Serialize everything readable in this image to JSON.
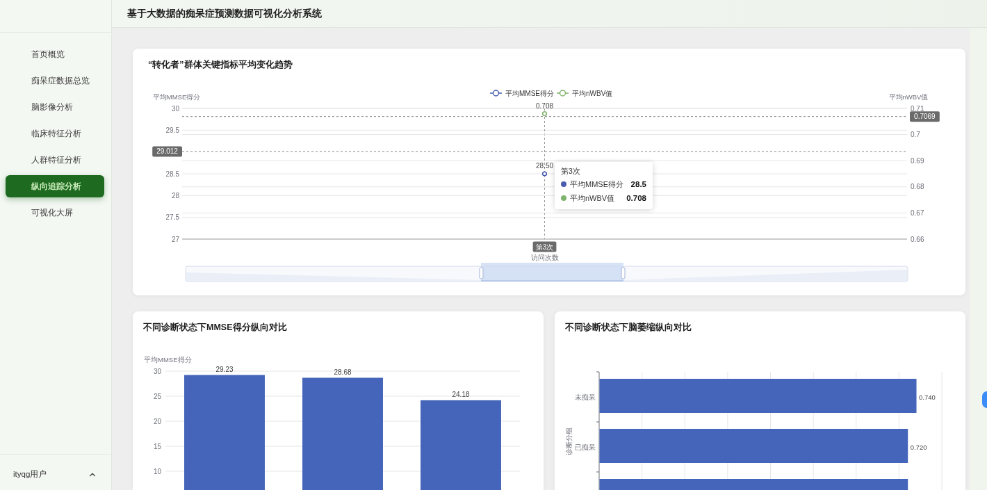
{
  "sidebar": {
    "nav_items": [
      {
        "label": "首页概览",
        "selected": false
      },
      {
        "label": "痴呆症数据总览",
        "selected": false
      },
      {
        "label": "脑影像分析",
        "selected": false
      },
      {
        "label": "临床特征分析",
        "selected": false
      },
      {
        "label": "人群特征分析",
        "selected": false
      },
      {
        "label": "纵向追踪分析",
        "selected": true
      },
      {
        "label": "可视化大屏",
        "selected": false
      }
    ],
    "user": {
      "name": "ityqg用户"
    }
  },
  "header": {
    "title": "基于大数据的痴呆症预测数据可视化分析系统"
  },
  "trend_card": {
    "title": "“转化者”群体关键指标平均变化趋势",
    "chart_data": {
      "type": "line",
      "xlabel": "访问次数",
      "ylabel": "平均MMSE得分",
      "categories": [
        "第3次"
      ],
      "series": [
        {
          "name": "平均MMSE得分",
          "color": "#4a5cb0",
          "marker": "circle",
          "values": [
            28.5
          ],
          "value_labels": [
            "28.50"
          ]
        }
      ],
      "ylim": [
        27,
        30
      ],
      "yticks": [
        27,
        27.5,
        28,
        28.5,
        29.5,
        30
      ],
      "grid": true,
      "ref_lines": [
        {
          "axis": "y",
          "value": 29.012,
          "label": "29.012"
        },
        {
          "axis": "x",
          "value": "第3次"
        }
      ]
    },
    "right_axis": {
      "chart_data": {
        "type": "line",
        "ylabel": "平均nWBV值",
        "series": [
          {
            "name": "平均nWBV值",
            "color": "#7fb46d",
            "marker": "circle",
            "values": [
              0.708
            ],
            "value_labels": [
              "0.708"
            ]
          }
        ],
        "ylim": [
          0.66,
          0.71
        ],
        "yticks": [
          0.66,
          0.67,
          0.68,
          0.69,
          0.7,
          0.71
        ],
        "grid": true,
        "ref_lines": [
          {
            "axis": "y",
            "value": 0.7069,
            "label": "0.7069"
          }
        ]
      }
    },
    "tooltip": {
      "title": "第3次",
      "rows": [
        {
          "name": "平均MMSE得分",
          "value": "28.5",
          "color": "#4a5cb0"
        },
        {
          "name": "平均nWBV值",
          "value": "0.708",
          "color": "#7fb46d"
        }
      ]
    }
  },
  "mmse_card": {
    "title": "不同诊断状态下MMSE得分纵向对比",
    "chart_data": {
      "type": "bar",
      "ylabel": "平均MMSE得分",
      "values": [
        29.23,
        28.68,
        24.18
      ],
      "ylim": [
        6.25,
        30
      ],
      "yticks": [
        10,
        15,
        20,
        25,
        30
      ],
      "grid": true,
      "data_labels": true
    }
  },
  "atrophy_card": {
    "title": "不同诊断状态下脑萎缩纵向对比",
    "chart_data": {
      "type": "bar",
      "orientation": "horizontal",
      "ylabel": "诊断分组",
      "categories": [
        "未痴呆",
        "已痴呆",
        null
      ],
      "values": [
        0.74,
        0.72,
        0.72
      ],
      "xlim": [
        0,
        0.8
      ],
      "grid": true,
      "value_labels": [
        "0.740",
        "0.720",
        null
      ]
    }
  }
}
